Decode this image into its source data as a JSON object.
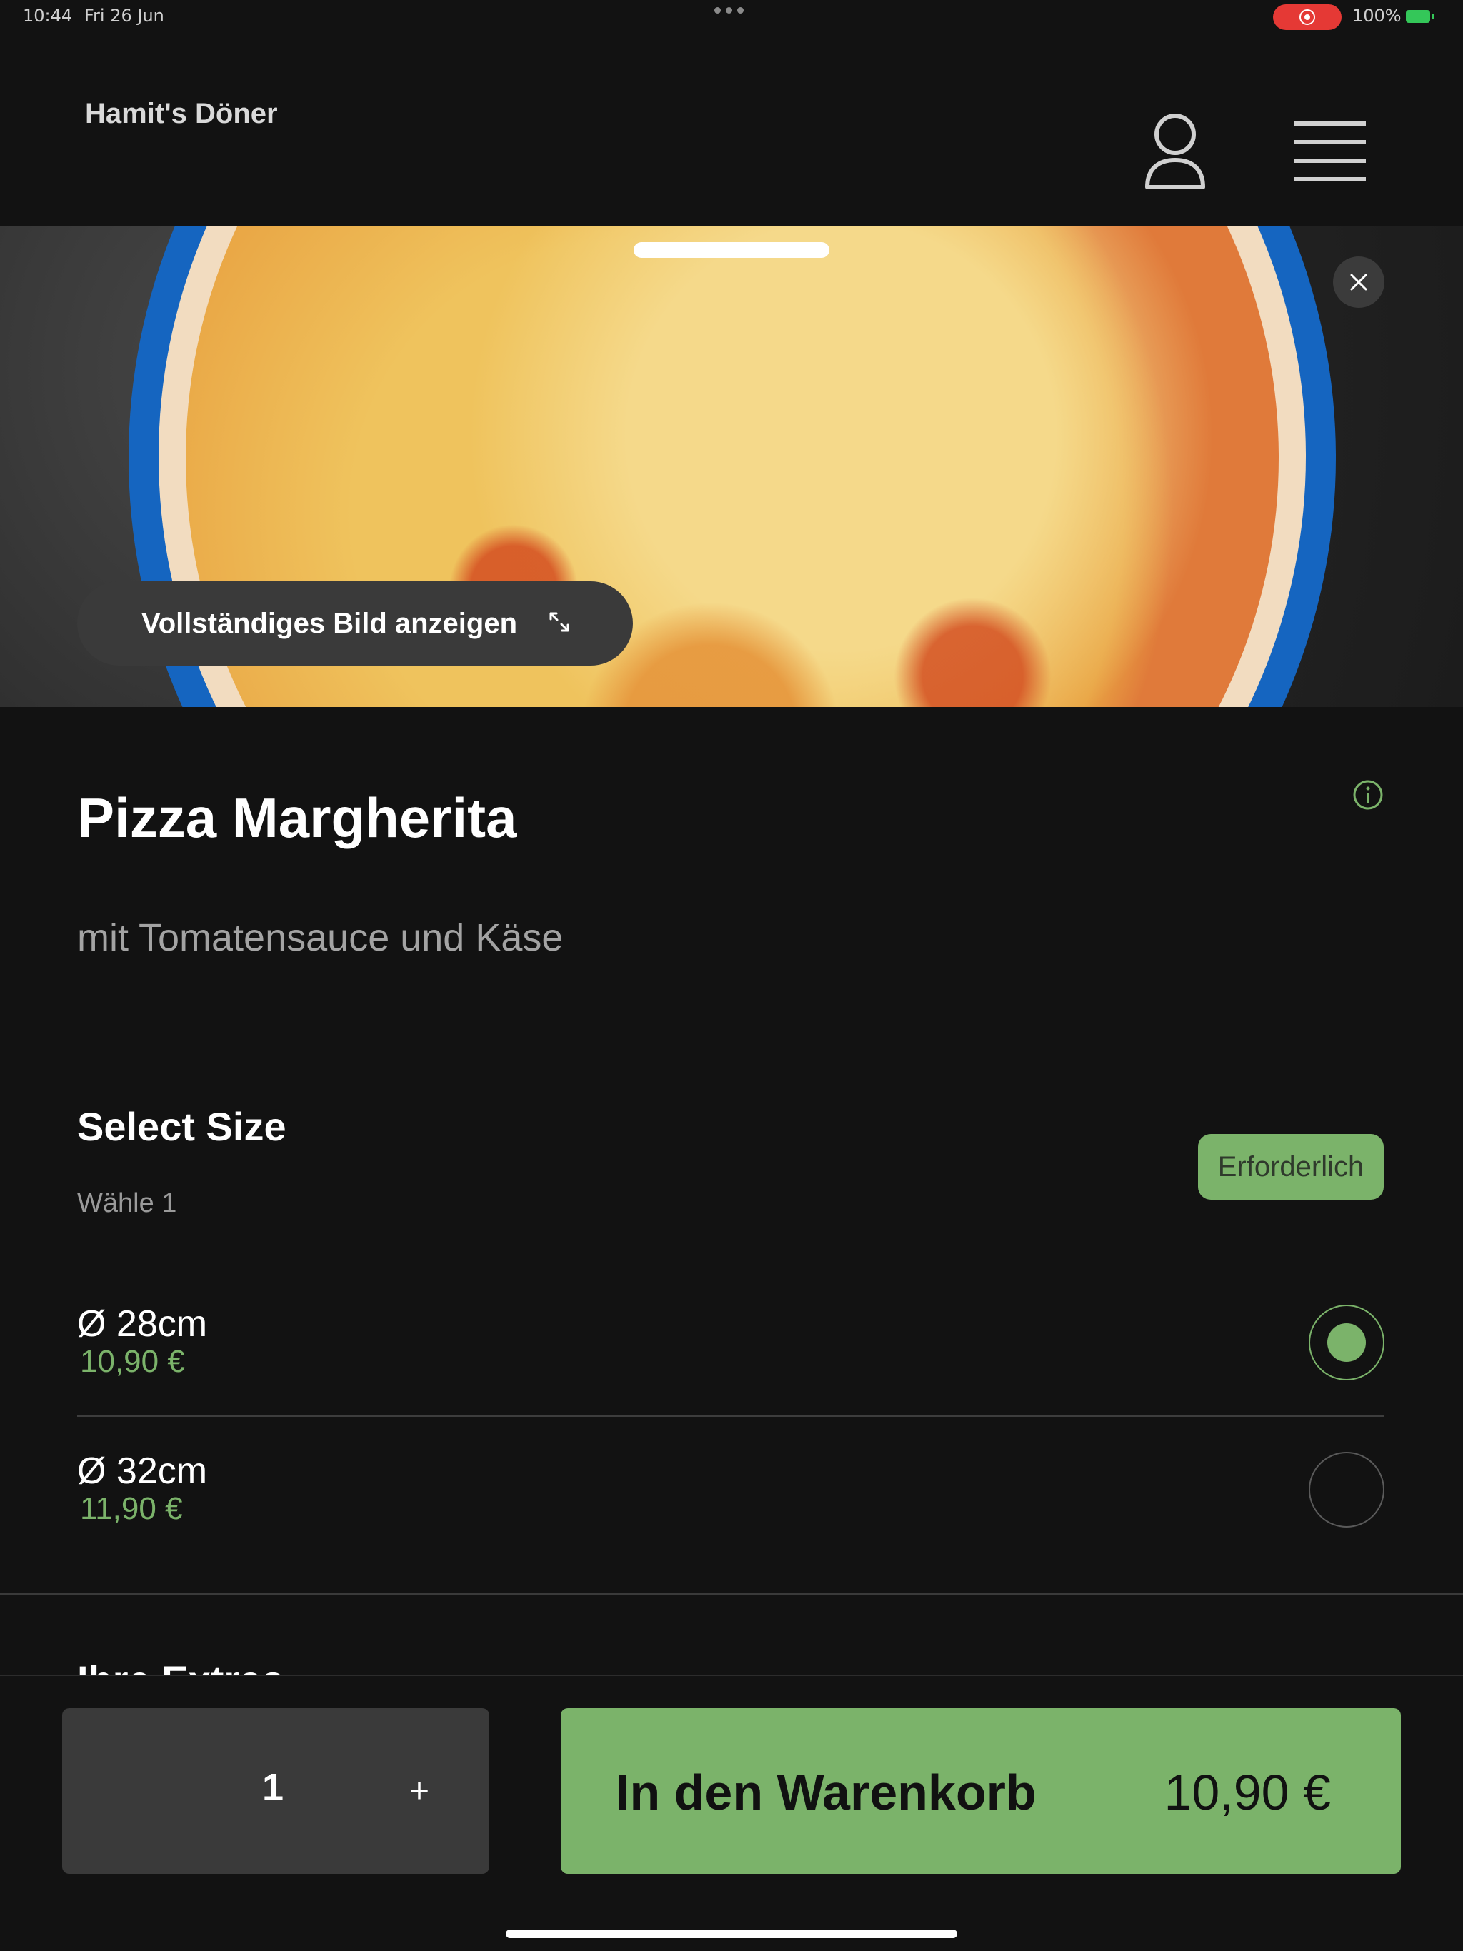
{
  "status_bar": {
    "time": "10:44",
    "date": "Fri 26 Jun",
    "battery": "100%"
  },
  "header": {
    "brand": "Hamit's Döner",
    "icons": [
      "user-icon",
      "menu-icon"
    ]
  },
  "hero": {
    "full_image_label": "Vollständiges Bild anzeigen",
    "icons": [
      "close-icon",
      "expand-icon"
    ]
  },
  "product": {
    "name": "Pizza Margherita",
    "description": "mit Tomatensauce und Käse"
  },
  "size_section": {
    "title": "Select Size",
    "hint": "Wähle 1",
    "required_label": "Erforderlich",
    "options": [
      {
        "name": "Ø 28cm",
        "price": "10,90 €",
        "selected": true
      },
      {
        "name": "Ø 32cm",
        "price": "11,90 €",
        "selected": false
      }
    ]
  },
  "next_section": {
    "title": "Ihre Extras"
  },
  "cart": {
    "quantity": "1",
    "plus": "+",
    "add_label": "In den Warenkorb",
    "total": "10,90 €"
  },
  "colors": {
    "accent": "#7bb36a",
    "background": "#121212",
    "plate": "#1565c0",
    "record": "#e53935"
  }
}
